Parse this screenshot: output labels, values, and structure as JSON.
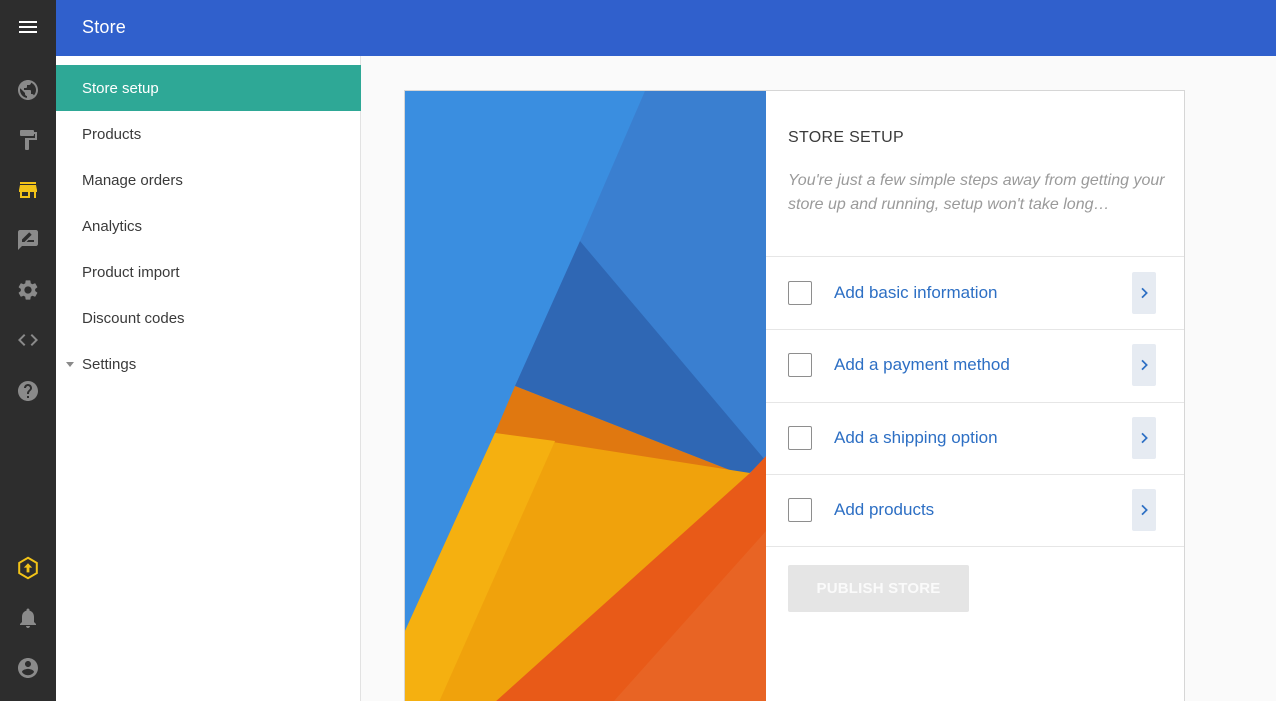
{
  "app": {
    "title": "Store"
  },
  "rail": {
    "icons": [
      "menu-icon",
      "globe-icon",
      "paint-roller-icon",
      "store-icon",
      "feedback-icon",
      "gear-icon",
      "code-icon",
      "help-icon",
      "upgrade-icon",
      "bell-icon",
      "account-icon"
    ],
    "active": "store-icon"
  },
  "subnav": {
    "items": [
      {
        "label": "Store setup",
        "active": true
      },
      {
        "label": "Products"
      },
      {
        "label": "Manage orders"
      },
      {
        "label": "Analytics"
      },
      {
        "label": "Product import"
      },
      {
        "label": "Discount codes"
      },
      {
        "label": "Settings",
        "expandable": true
      }
    ]
  },
  "setup": {
    "heading": "STORE SETUP",
    "intro": "You're just a few simple steps away from getting your store up and running, setup won't take long…",
    "steps": [
      {
        "label": "Add basic information",
        "checked": false
      },
      {
        "label": "Add a payment method",
        "checked": false
      },
      {
        "label": "Add a shipping option",
        "checked": false
      },
      {
        "label": "Add products",
        "checked": false
      }
    ],
    "publish_label": "PUBLISH STORE",
    "publish_enabled": false
  },
  "colors": {
    "topbar": "#3060cc",
    "rail": "#2d2d2d",
    "active_nav": "#2ea896",
    "link": "#2d6fc4",
    "rail_accent": "#f2c318"
  }
}
